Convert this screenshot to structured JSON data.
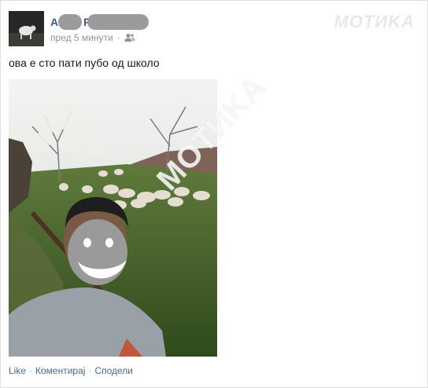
{
  "post": {
    "author_initial": "A",
    "author_mid_letter": "P",
    "timestamp": "пред 5 минути",
    "separator": "·",
    "privacy_icon": "friends-icon",
    "text": "ова е сто пати пубо од школо"
  },
  "watermark": {
    "top": "MOTИKA",
    "diagonal": "MOTИKA"
  },
  "actions": {
    "like": "Like",
    "comment": "Коментирај",
    "share": "Сподели",
    "dot": "·"
  },
  "colors": {
    "link": "#3b5998",
    "muted": "#90949c",
    "action": "#4b67a1",
    "border": "#dddfe2"
  }
}
